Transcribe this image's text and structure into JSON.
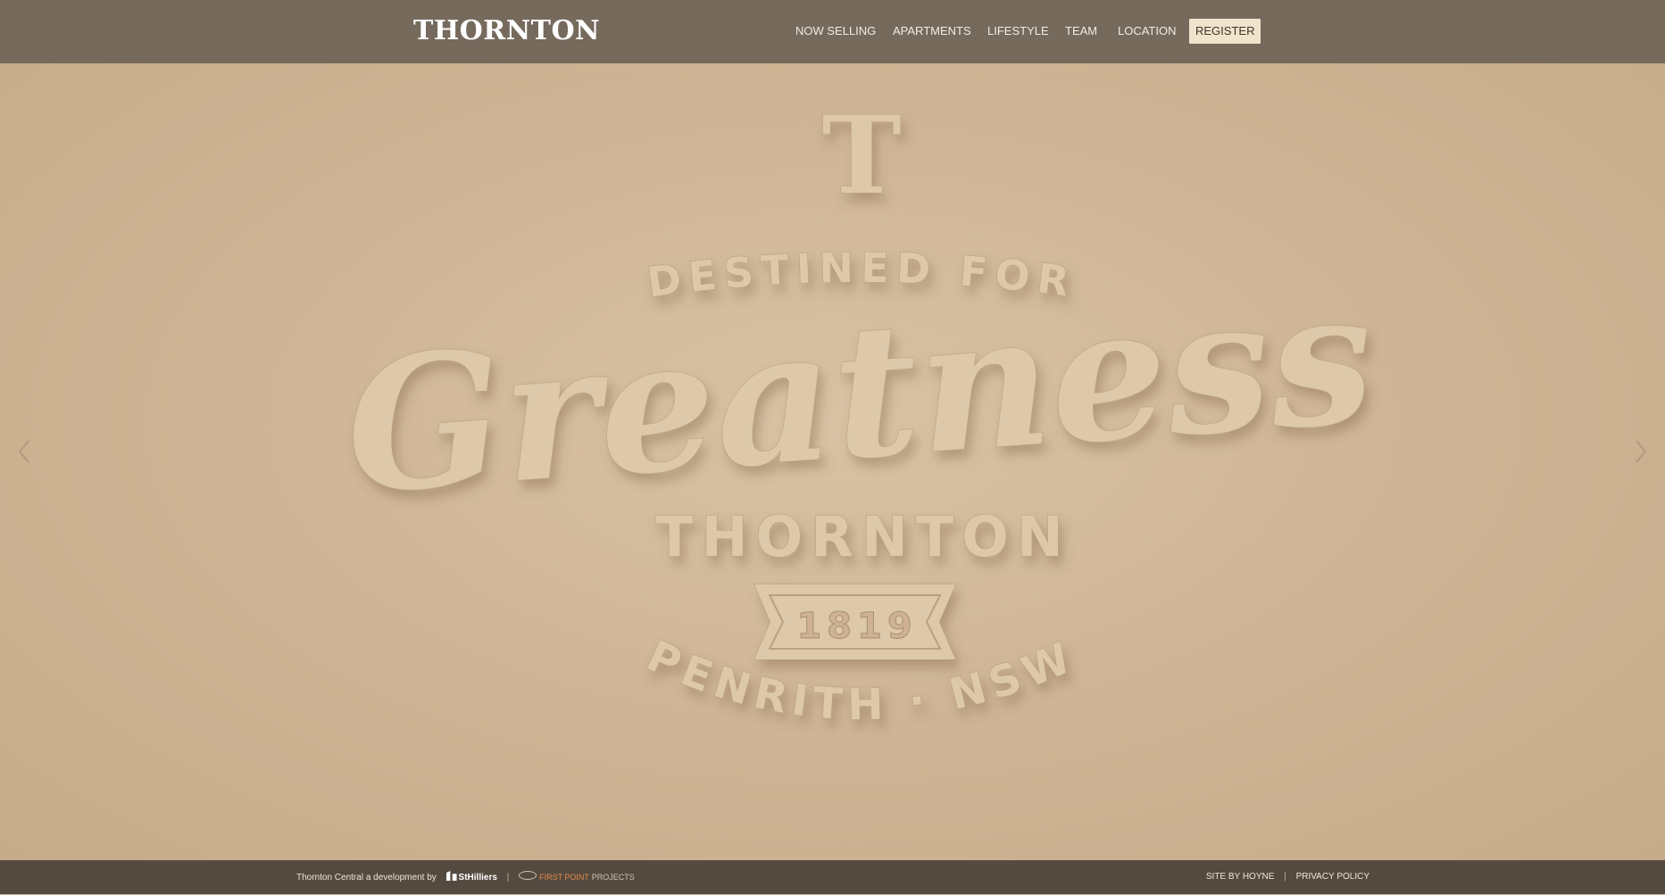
{
  "header": {
    "logo": "THORNTON",
    "nav": [
      "NOW SELLING",
      "APARTMENTS",
      "LIFESTYLE",
      "TEAM",
      "LOCATION"
    ],
    "register_label": "REGISTER"
  },
  "hero": {
    "monogram": "T",
    "line_top": "DESTINED FOR",
    "script_word": "Greatness",
    "name": "THORNTON",
    "year": "1819",
    "location": "PENRITH · NSW",
    "prev_icon": "chevron-left-icon",
    "next_icon": "chevron-right-icon"
  },
  "footer": {
    "credit_text": "Thornton Central a development by",
    "brand_1": "StHilliers",
    "divider": "|",
    "brand_2a": "FIRST POINT",
    "brand_2b": "PROJECTS",
    "site_by": "SITE BY HOYNE",
    "link_sep": "|",
    "privacy": "PRIVACY POLICY"
  },
  "colors": {
    "header_bg": "#766a5d",
    "hero_bg": "#cdb393",
    "footer_bg": "#554a3f",
    "register_bg": "#f1e4cc",
    "accent_orange": "#e0894a"
  }
}
